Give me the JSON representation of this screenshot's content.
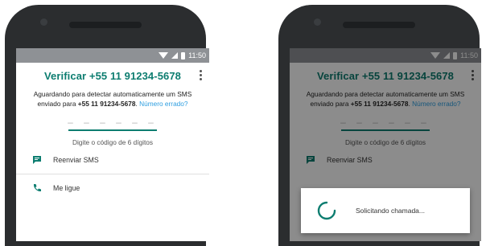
{
  "status_bar": {
    "time": "11:50"
  },
  "verify": {
    "title": "Verificar +55 11 91234-5678",
    "desc_prefix": "Aguardando para detectar automaticamente um SMS enviado para ",
    "desc_number": "+55 11 91234-5678",
    "desc_suffix": ". ",
    "wrong_number_link": "Número errado?",
    "code_placeholder": "– – –   – – –",
    "code_hint": "Digite o código de 6 dígitos",
    "resend_sms": "Reenviar SMS",
    "call_me": "Me ligue"
  },
  "dialog": {
    "message": "Solicitando chamada..."
  },
  "colors": {
    "accent": "#0d7d70",
    "link": "#2d9ee0",
    "bezel": "#2b2d2f"
  },
  "icons": {
    "resend": "message-icon",
    "call": "phone-icon",
    "menu": "more-vert-icon"
  }
}
